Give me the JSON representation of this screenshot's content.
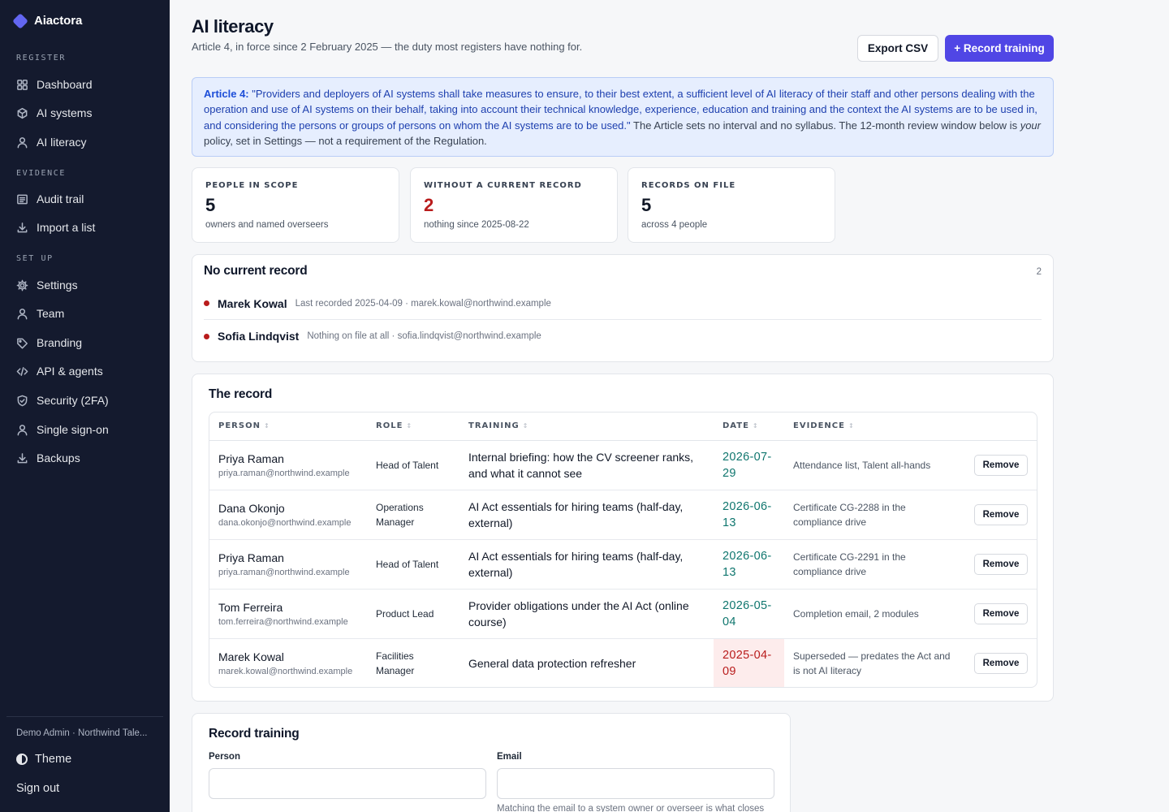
{
  "brand": {
    "name": "Aiactora"
  },
  "nav": {
    "sections": [
      {
        "label": "REGISTER"
      },
      {
        "label": "EVIDENCE"
      },
      {
        "label": "SET UP"
      }
    ],
    "items": [
      {
        "label": "Dashboard",
        "icon": "grid-icon"
      },
      {
        "label": "AI systems",
        "icon": "cube-icon"
      },
      {
        "label": "AI literacy",
        "icon": "user-icon"
      },
      {
        "label": "Audit trail",
        "icon": "list-icon"
      },
      {
        "label": "Import a list",
        "icon": "download-icon"
      },
      {
        "label": "Settings",
        "icon": "gear-icon"
      },
      {
        "label": "Team",
        "icon": "user-icon"
      },
      {
        "label": "Branding",
        "icon": "tag-icon"
      },
      {
        "label": "API & agents",
        "icon": "code-icon"
      },
      {
        "label": "Security (2FA)",
        "icon": "shield-icon"
      },
      {
        "label": "Single sign-on",
        "icon": "user-icon"
      },
      {
        "label": "Backups",
        "icon": "download-icon"
      }
    ],
    "user": "Demo Admin · Northwind Tale...",
    "theme": "Theme",
    "signout": "Sign out"
  },
  "header": {
    "title": "AI literacy",
    "subtitle": "Article 4, in force since 2 February 2025 — the duty most registers have nothing for.",
    "export_label": "Export CSV",
    "record_label": "+ Record training"
  },
  "callout": {
    "lead": "Article 4:",
    "quote": " \"Providers and deployers of AI systems shall take measures to ensure, to their best extent, a sufficient level of AI literacy of their staff and other persons dealing with the operation and use of AI systems on their behalf, taking into account their technical knowledge, experience, education and training and the context the AI systems are to be used in, and considering the persons or groups of persons on whom the AI systems are to be used.\"",
    "rest1": " The Article sets no interval and no syllabus. The 12-month review window below is ",
    "emph": "your",
    "rest2": " policy, set in Settings — not a requirement of the Regulation."
  },
  "stats": [
    {
      "label": "PEOPLE IN SCOPE",
      "value": "5",
      "note": "owners and named overseers"
    },
    {
      "label": "WITHOUT A CURRENT RECORD",
      "value": "2",
      "note": "nothing since 2025-08-22"
    },
    {
      "label": "RECORDS ON FILE",
      "value": "5",
      "note": "across 4 people"
    }
  ],
  "no_record": {
    "title": "No current record",
    "count": "2",
    "items": [
      {
        "name": "Marek Kowal",
        "meta": "Last recorded 2025-04-09 · marek.kowal@northwind.example"
      },
      {
        "name": "Sofia Lindqvist",
        "meta": "Nothing on file at all · sofia.lindqvist@northwind.example"
      }
    ]
  },
  "record": {
    "title": "The record",
    "columns": [
      "PERSON",
      "ROLE",
      "TRAINING",
      "DATE",
      "EVIDENCE"
    ],
    "remove_label": "Remove",
    "rows": [
      {
        "name": "Priya Raman",
        "email": "priya.raman@northwind.example",
        "role": "Head of Talent",
        "training": "Internal briefing: how the CV screener ranks, and what it cannot see",
        "date": "2026-07-29",
        "evidence": "Attendance list, Talent all-hands"
      },
      {
        "name": "Dana Okonjo",
        "email": "dana.okonjo@northwind.example",
        "role": "Operations Manager",
        "training": "AI Act essentials for hiring teams (half-day, external)",
        "date": "2026-06-13",
        "evidence": "Certificate CG-2288 in the compliance drive"
      },
      {
        "name": "Priya Raman",
        "email": "priya.raman@northwind.example",
        "role": "Head of Talent",
        "training": "AI Act essentials for hiring teams (half-day, external)",
        "date": "2026-06-13",
        "evidence": "Certificate CG-2291 in the compliance drive"
      },
      {
        "name": "Tom Ferreira",
        "email": "tom.ferreira@northwind.example",
        "role": "Product Lead",
        "training": "Provider obligations under the AI Act (online course)",
        "date": "2026-05-04",
        "evidence": "Completion email, 2 modules"
      },
      {
        "name": "Marek Kowal",
        "email": "marek.kowal@northwind.example",
        "role": "Facilities Manager",
        "training": "General data protection refresher",
        "date": "2025-04-09",
        "evidence": "Superseded — predates the Act and is not AI literacy"
      }
    ]
  },
  "form": {
    "title": "Record training",
    "person_label": "Person",
    "email_label": "Email",
    "person_value": "",
    "email_value": "",
    "email_hint": "Matching the email to a system owner or overseer is what closes"
  }
}
